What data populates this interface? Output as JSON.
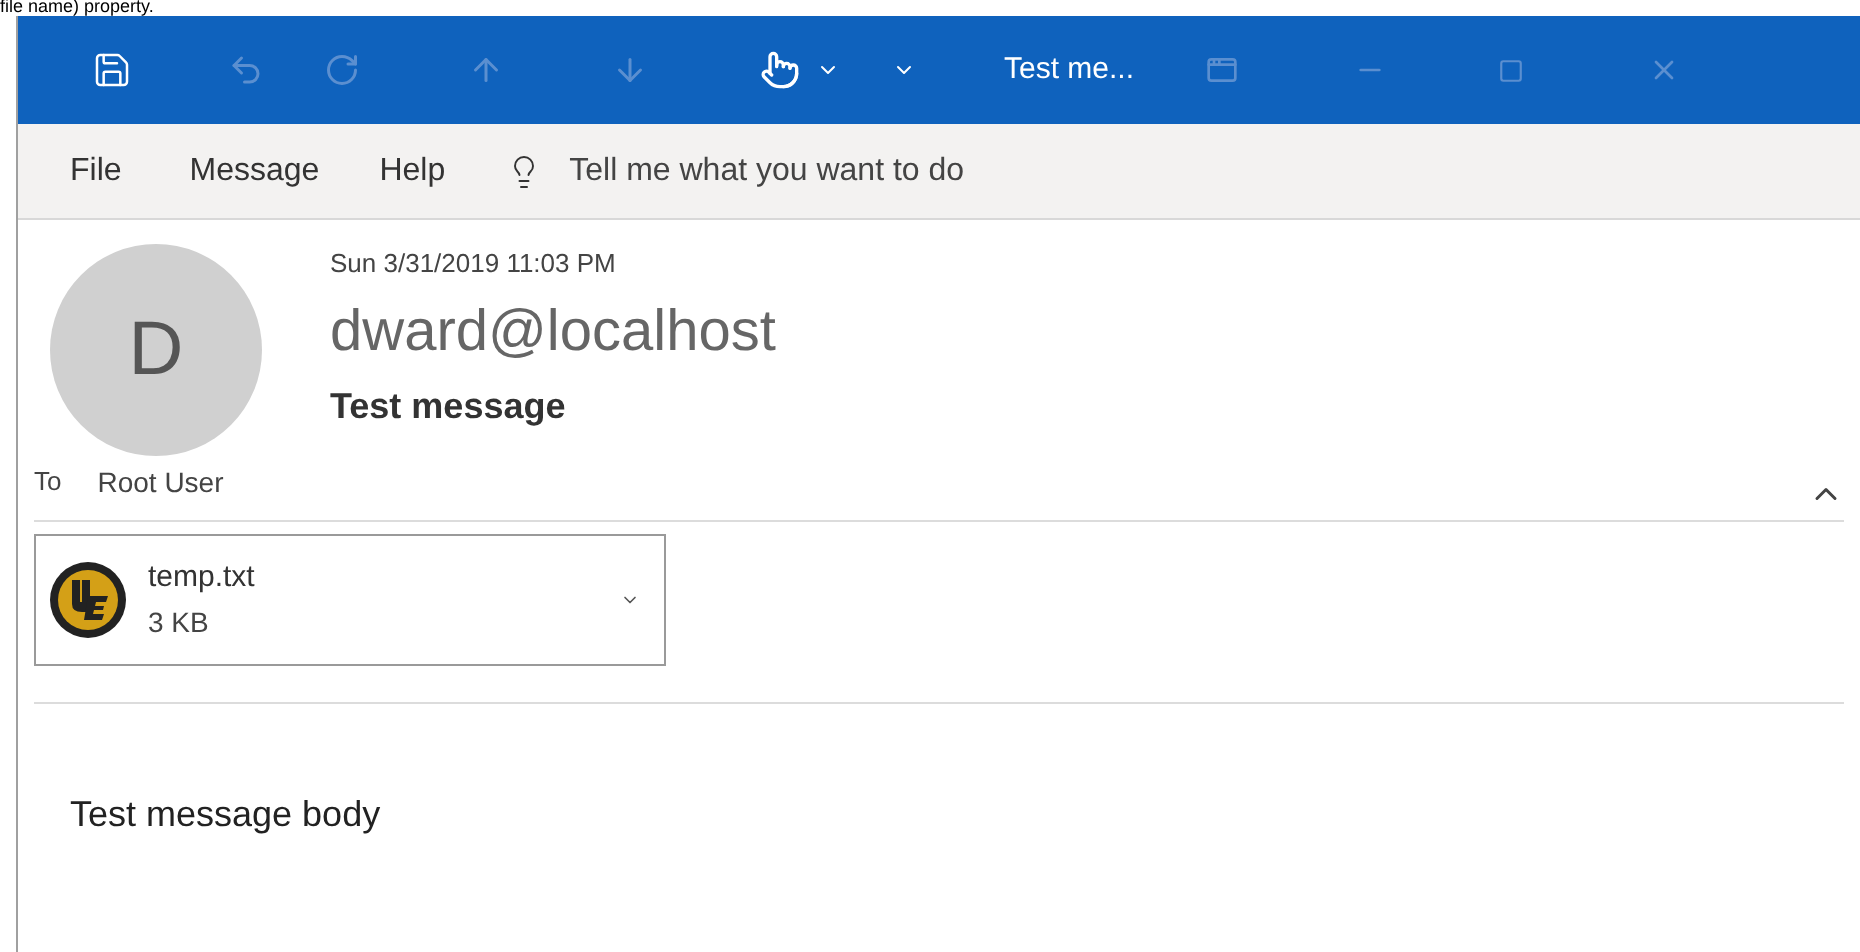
{
  "page_caption": "file name) property.",
  "window": {
    "title": "Test me..."
  },
  "menu": [
    {
      "label": "File"
    },
    {
      "label": "Message"
    },
    {
      "label": "Help"
    }
  ],
  "tell_me": {
    "placeholder": "Tell me what you want to do"
  },
  "message": {
    "date": "Sun 3/31/2019 11:03 PM",
    "sender": "dward@localhost",
    "avatar_initial": "D",
    "subject": "Test message",
    "to_label": "To",
    "recipient": "Root User"
  },
  "attachment": {
    "name": "temp.txt",
    "size": "3 KB"
  },
  "body": "Test message body"
}
